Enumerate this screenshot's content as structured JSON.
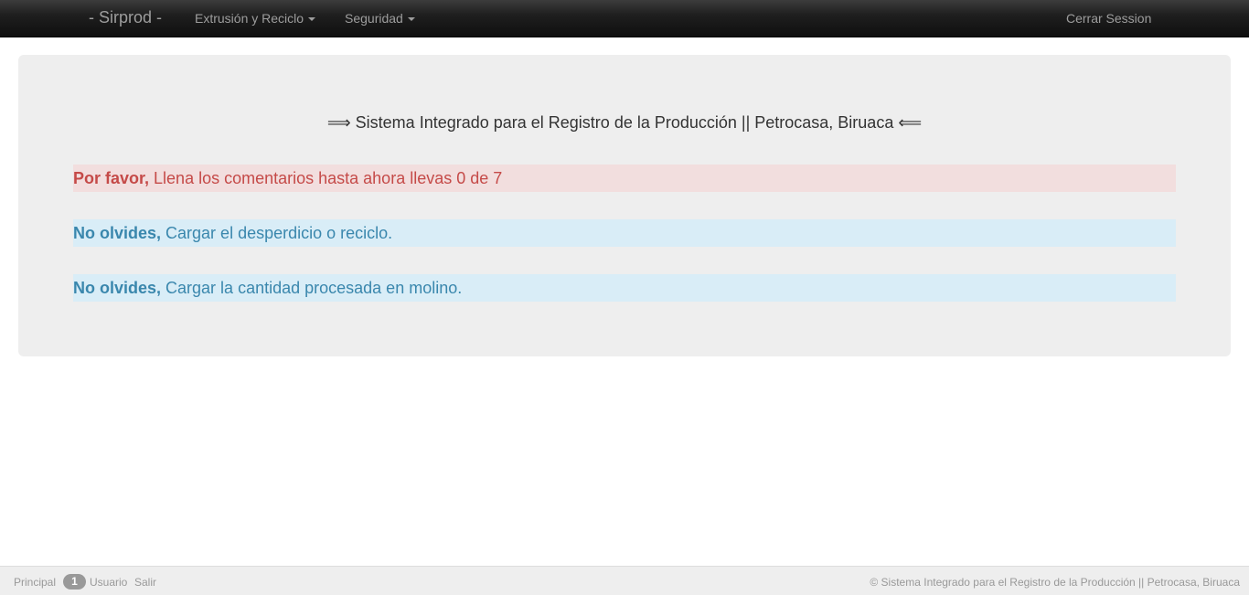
{
  "navbar": {
    "brand": "- Sirprod -",
    "menu": [
      {
        "label": "Extrusión y Reciclo"
      },
      {
        "label": "Seguridad"
      }
    ],
    "logout": "Cerrar Session"
  },
  "main": {
    "title": "⟹ Sistema Integrado para el Registro de la Producción || Petrocasa, Biruaca ⟸",
    "alerts": [
      {
        "type": "danger",
        "strong": "Por favor,",
        "text": " Llena los comentarios hasta ahora llevas 0 de 7"
      },
      {
        "type": "info",
        "strong": "No olvides,",
        "text": " Cargar el desperdicio o reciclo."
      },
      {
        "type": "info",
        "strong": "No olvides,",
        "text": " Cargar la cantidad procesada en molino."
      }
    ]
  },
  "footer": {
    "links": [
      {
        "label": "Principal"
      },
      {
        "label": "Usuario"
      },
      {
        "label": "Salir"
      }
    ],
    "badge": "1",
    "copyright": "© Sistema Integrado para el Registro de la Producción || Petrocasa, Biruaca"
  },
  "colors": {
    "navbar_bg": "#1f1f1f",
    "nav_text": "#9d9d9d",
    "panel_bg": "#eeeeee",
    "danger_bg": "#f2dede",
    "danger_text": "#c54a48",
    "info_bg": "#d9edf7",
    "info_text": "#3a87ad"
  }
}
